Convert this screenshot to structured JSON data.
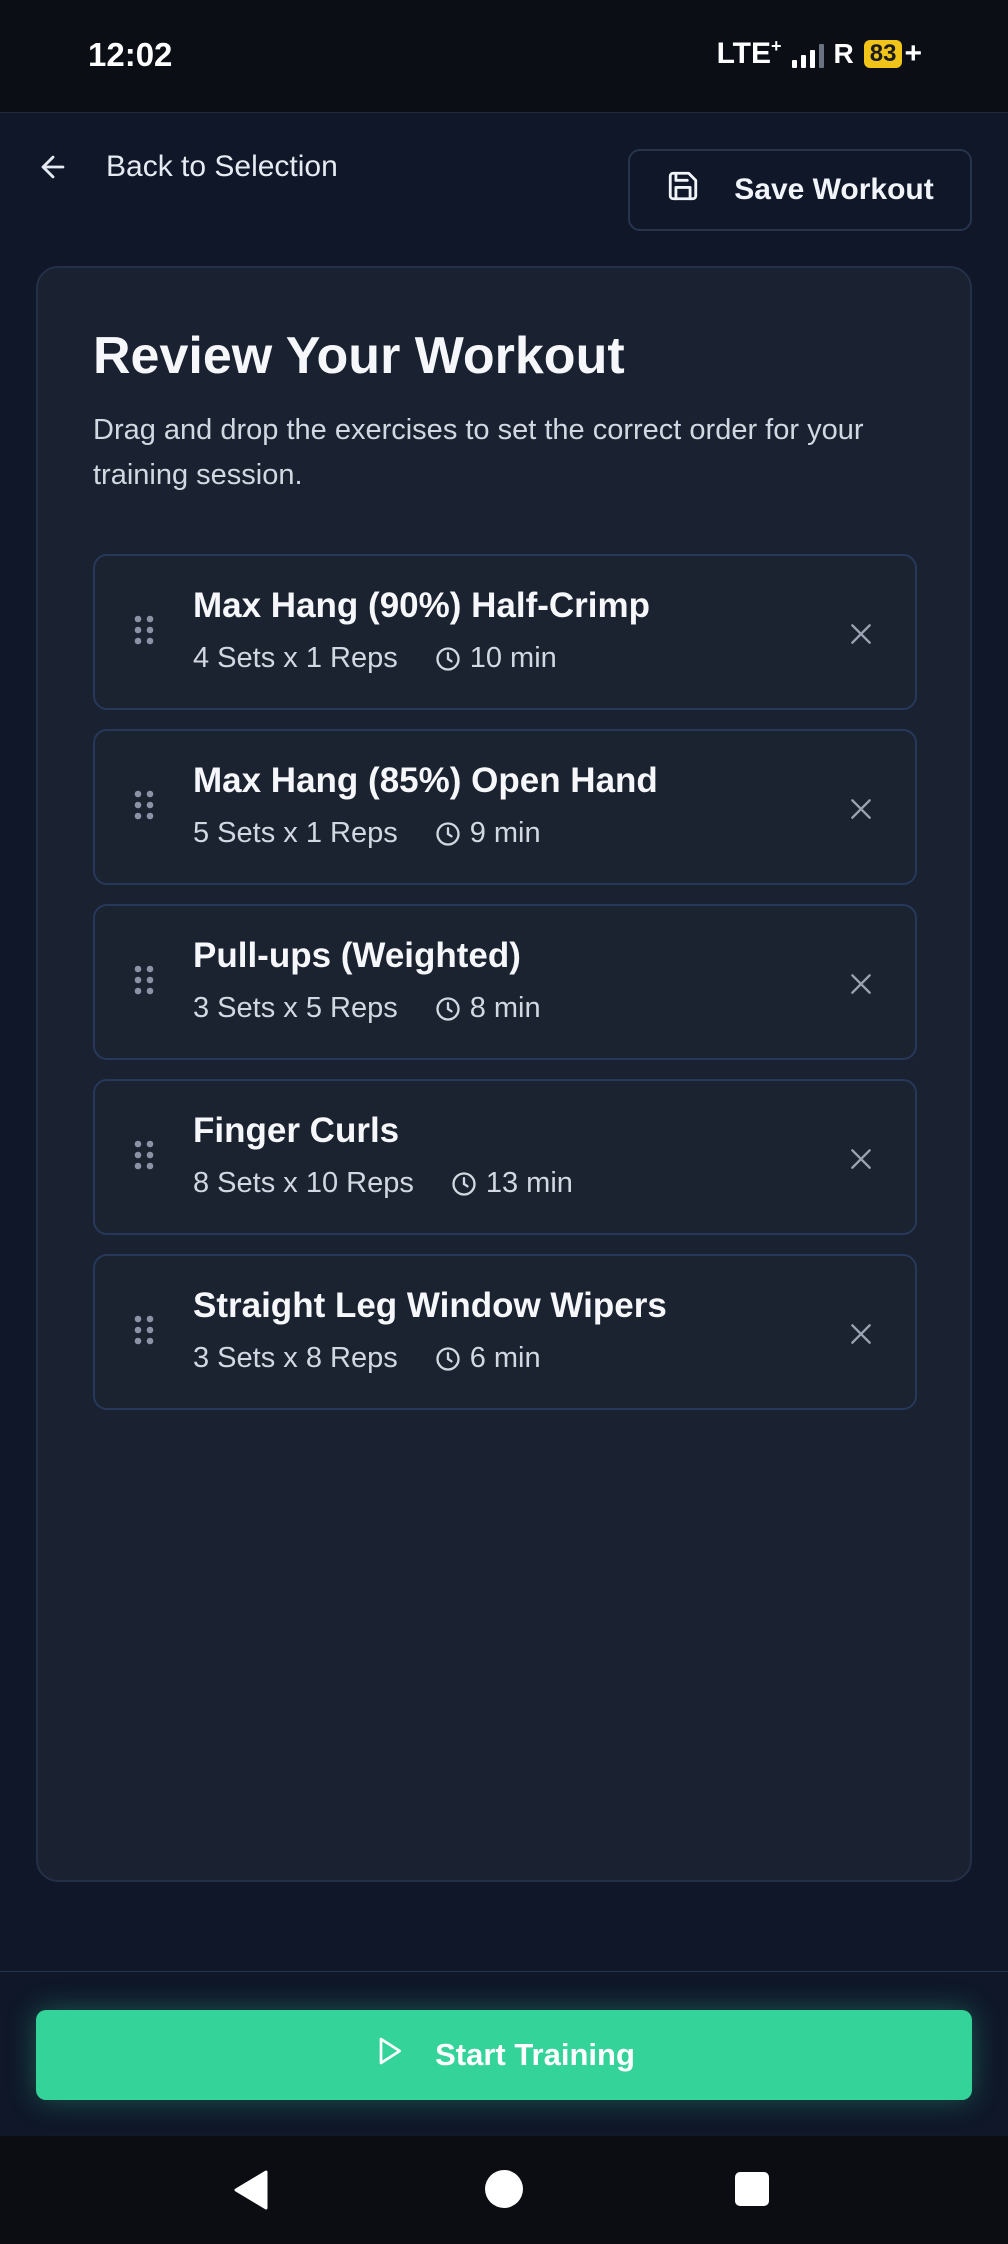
{
  "status_bar": {
    "time": "12:02",
    "network": "LTE",
    "network_suffix": "+",
    "roaming": "R",
    "battery_level": "83",
    "battery_charging_symbol": "+"
  },
  "header": {
    "back_label": "Back to Selection",
    "back_icon": "arrow-left-icon",
    "save_label": "Save Workout",
    "save_icon": "floppy-disk-icon"
  },
  "review": {
    "title": "Review Your Workout",
    "description": "Drag and drop the exercises to set the correct order for your training session."
  },
  "exercises": [
    {
      "name": "Max Hang (90%) Half-Crimp",
      "sets_reps": "4 Sets x 1 Reps",
      "duration": "10 min"
    },
    {
      "name": "Max Hang (85%) Open Hand",
      "sets_reps": "5 Sets x 1 Reps",
      "duration": "9 min"
    },
    {
      "name": "Pull-ups (Weighted)",
      "sets_reps": "3 Sets x 5 Reps",
      "duration": "8 min"
    },
    {
      "name": "Finger Curls",
      "sets_reps": "8 Sets x 10 Reps",
      "duration": "13 min"
    },
    {
      "name": "Straight Leg Window Wipers",
      "sets_reps": "3 Sets x 8 Reps",
      "duration": "6 min"
    }
  ],
  "footer": {
    "start_label": "Start Training",
    "start_icon": "play-icon"
  },
  "colors": {
    "background": "#0f1729",
    "card": "#1a2231",
    "accent": "#34d399",
    "battery": "#f0c419"
  }
}
